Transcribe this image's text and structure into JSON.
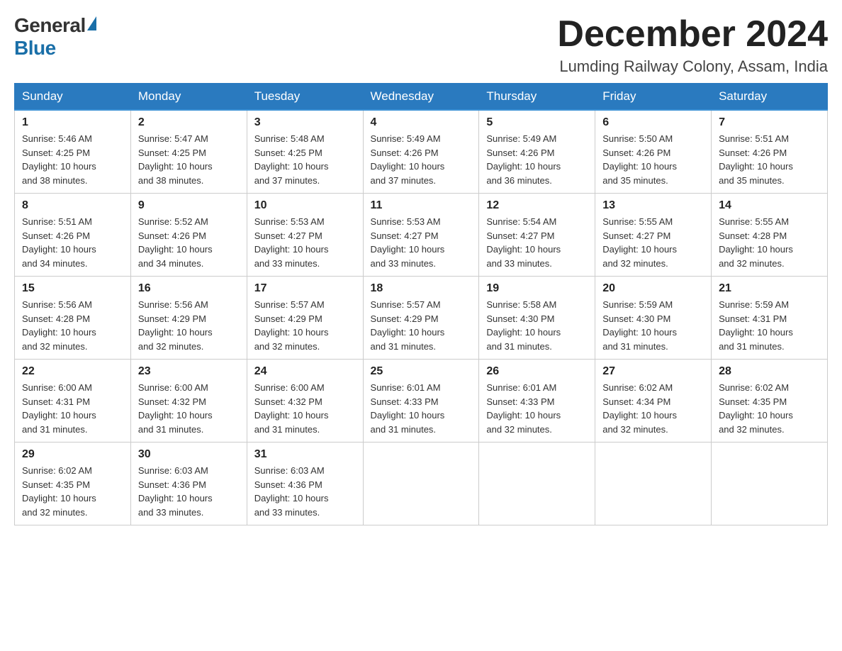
{
  "logo": {
    "general": "General",
    "blue": "Blue"
  },
  "title": {
    "month": "December 2024",
    "location": "Lumding Railway Colony, Assam, India"
  },
  "weekdays": [
    "Sunday",
    "Monday",
    "Tuesday",
    "Wednesday",
    "Thursday",
    "Friday",
    "Saturday"
  ],
  "weeks": [
    [
      {
        "day": "1",
        "sunrise": "5:46 AM",
        "sunset": "4:25 PM",
        "daylight": "10 hours and 38 minutes."
      },
      {
        "day": "2",
        "sunrise": "5:47 AM",
        "sunset": "4:25 PM",
        "daylight": "10 hours and 38 minutes."
      },
      {
        "day": "3",
        "sunrise": "5:48 AM",
        "sunset": "4:25 PM",
        "daylight": "10 hours and 37 minutes."
      },
      {
        "day": "4",
        "sunrise": "5:49 AM",
        "sunset": "4:26 PM",
        "daylight": "10 hours and 37 minutes."
      },
      {
        "day": "5",
        "sunrise": "5:49 AM",
        "sunset": "4:26 PM",
        "daylight": "10 hours and 36 minutes."
      },
      {
        "day": "6",
        "sunrise": "5:50 AM",
        "sunset": "4:26 PM",
        "daylight": "10 hours and 35 minutes."
      },
      {
        "day": "7",
        "sunrise": "5:51 AM",
        "sunset": "4:26 PM",
        "daylight": "10 hours and 35 minutes."
      }
    ],
    [
      {
        "day": "8",
        "sunrise": "5:51 AM",
        "sunset": "4:26 PM",
        "daylight": "10 hours and 34 minutes."
      },
      {
        "day": "9",
        "sunrise": "5:52 AM",
        "sunset": "4:26 PM",
        "daylight": "10 hours and 34 minutes."
      },
      {
        "day": "10",
        "sunrise": "5:53 AM",
        "sunset": "4:27 PM",
        "daylight": "10 hours and 33 minutes."
      },
      {
        "day": "11",
        "sunrise": "5:53 AM",
        "sunset": "4:27 PM",
        "daylight": "10 hours and 33 minutes."
      },
      {
        "day": "12",
        "sunrise": "5:54 AM",
        "sunset": "4:27 PM",
        "daylight": "10 hours and 33 minutes."
      },
      {
        "day": "13",
        "sunrise": "5:55 AM",
        "sunset": "4:27 PM",
        "daylight": "10 hours and 32 minutes."
      },
      {
        "day": "14",
        "sunrise": "5:55 AM",
        "sunset": "4:28 PM",
        "daylight": "10 hours and 32 minutes."
      }
    ],
    [
      {
        "day": "15",
        "sunrise": "5:56 AM",
        "sunset": "4:28 PM",
        "daylight": "10 hours and 32 minutes."
      },
      {
        "day": "16",
        "sunrise": "5:56 AM",
        "sunset": "4:29 PM",
        "daylight": "10 hours and 32 minutes."
      },
      {
        "day": "17",
        "sunrise": "5:57 AM",
        "sunset": "4:29 PM",
        "daylight": "10 hours and 32 minutes."
      },
      {
        "day": "18",
        "sunrise": "5:57 AM",
        "sunset": "4:29 PM",
        "daylight": "10 hours and 31 minutes."
      },
      {
        "day": "19",
        "sunrise": "5:58 AM",
        "sunset": "4:30 PM",
        "daylight": "10 hours and 31 minutes."
      },
      {
        "day": "20",
        "sunrise": "5:59 AM",
        "sunset": "4:30 PM",
        "daylight": "10 hours and 31 minutes."
      },
      {
        "day": "21",
        "sunrise": "5:59 AM",
        "sunset": "4:31 PM",
        "daylight": "10 hours and 31 minutes."
      }
    ],
    [
      {
        "day": "22",
        "sunrise": "6:00 AM",
        "sunset": "4:31 PM",
        "daylight": "10 hours and 31 minutes."
      },
      {
        "day": "23",
        "sunrise": "6:00 AM",
        "sunset": "4:32 PM",
        "daylight": "10 hours and 31 minutes."
      },
      {
        "day": "24",
        "sunrise": "6:00 AM",
        "sunset": "4:32 PM",
        "daylight": "10 hours and 31 minutes."
      },
      {
        "day": "25",
        "sunrise": "6:01 AM",
        "sunset": "4:33 PM",
        "daylight": "10 hours and 31 minutes."
      },
      {
        "day": "26",
        "sunrise": "6:01 AM",
        "sunset": "4:33 PM",
        "daylight": "10 hours and 32 minutes."
      },
      {
        "day": "27",
        "sunrise": "6:02 AM",
        "sunset": "4:34 PM",
        "daylight": "10 hours and 32 minutes."
      },
      {
        "day": "28",
        "sunrise": "6:02 AM",
        "sunset": "4:35 PM",
        "daylight": "10 hours and 32 minutes."
      }
    ],
    [
      {
        "day": "29",
        "sunrise": "6:02 AM",
        "sunset": "4:35 PM",
        "daylight": "10 hours and 32 minutes."
      },
      {
        "day": "30",
        "sunrise": "6:03 AM",
        "sunset": "4:36 PM",
        "daylight": "10 hours and 33 minutes."
      },
      {
        "day": "31",
        "sunrise": "6:03 AM",
        "sunset": "4:36 PM",
        "daylight": "10 hours and 33 minutes."
      },
      null,
      null,
      null,
      null
    ]
  ],
  "labels": {
    "sunrise": "Sunrise: ",
    "sunset": "Sunset: ",
    "daylight": "Daylight: "
  }
}
